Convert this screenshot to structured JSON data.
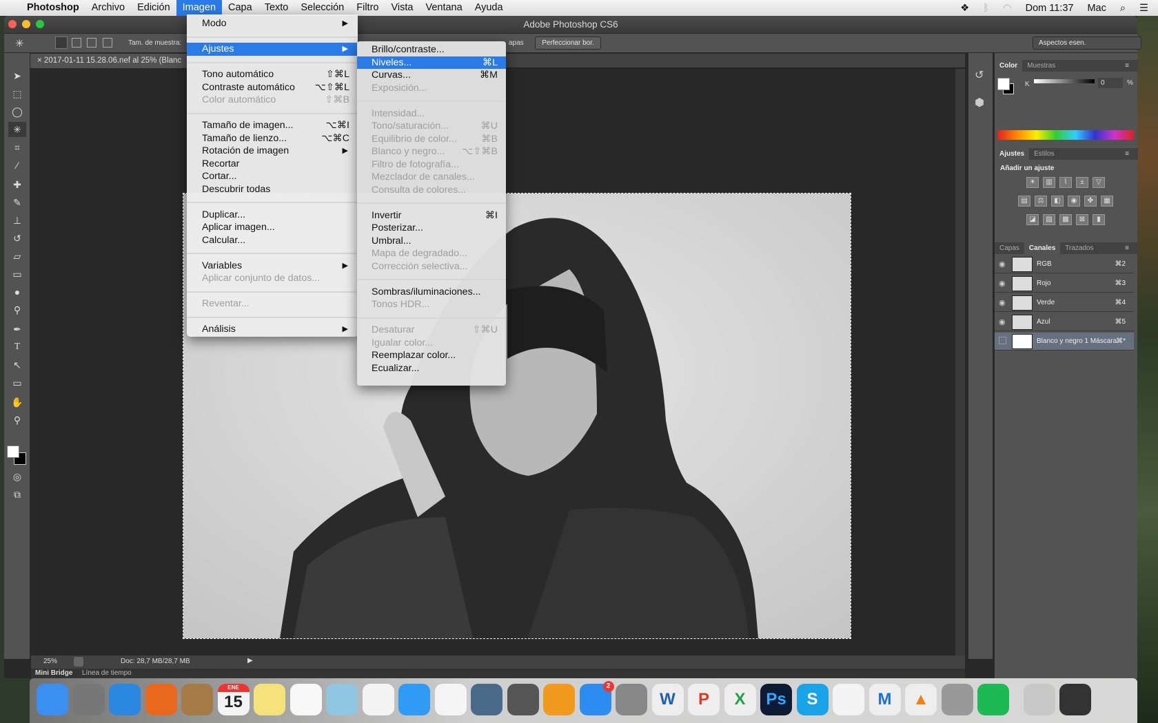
{
  "menubar": {
    "app": "Photoshop",
    "items": [
      "Archivo",
      "Edición",
      "Imagen",
      "Capa",
      "Texto",
      "Selección",
      "Filtro",
      "Vista",
      "Ventana",
      "Ayuda"
    ],
    "active": "Imagen",
    "clock": "Dom 11:37",
    "user": "Mac"
  },
  "window": {
    "title": "Adobe Photoshop CS6"
  },
  "options": {
    "sample_label": "Tam. de muestra:",
    "refine_button": "Perfeccionar bor.",
    "workspace": "Aspectos esen.",
    "layers_fragment": "apas"
  },
  "document": {
    "tab": "2017-01-11 15.28.06.nef al 25% (Blanc"
  },
  "status": {
    "zoom": "25%",
    "doc": "Doc: 28,7 MB/28,7 MB"
  },
  "bottom_tabs": [
    "Mini Bridge",
    "Línea de tiempo"
  ],
  "imagen_menu": [
    {
      "label": "Modo",
      "submenu": true
    },
    {
      "sep": true
    },
    {
      "label": "Ajustes",
      "submenu": true,
      "highlighted": true
    },
    {
      "sep": true
    },
    {
      "label": "Tono automático",
      "key": "⇧⌘L"
    },
    {
      "label": "Contraste automático",
      "key": "⌥⇧⌘L"
    },
    {
      "label": "Color automático",
      "key": "⇧⌘B",
      "disabled": true
    },
    {
      "sep": true
    },
    {
      "label": "Tamaño de imagen...",
      "key": "⌥⌘I"
    },
    {
      "label": "Tamaño de lienzo...",
      "key": "⌥⌘C"
    },
    {
      "label": "Rotación de imagen",
      "submenu": true
    },
    {
      "label": "Recortar"
    },
    {
      "label": "Cortar..."
    },
    {
      "label": "Descubrir todas"
    },
    {
      "sep": true
    },
    {
      "label": "Duplicar..."
    },
    {
      "label": "Aplicar imagen..."
    },
    {
      "label": "Calcular..."
    },
    {
      "sep": true
    },
    {
      "label": "Variables",
      "submenu": true
    },
    {
      "label": "Aplicar conjunto de datos...",
      "disabled": true
    },
    {
      "sep": true
    },
    {
      "label": "Reventar...",
      "disabled": true
    },
    {
      "sep": true
    },
    {
      "label": "Análisis",
      "submenu": true
    }
  ],
  "ajustes_submenu": [
    {
      "label": "Brillo/contraste..."
    },
    {
      "label": "Niveles...",
      "key": "⌘L",
      "highlighted": true
    },
    {
      "label": "Curvas...",
      "key": "⌘M"
    },
    {
      "label": "Exposición...",
      "disabled": true
    },
    {
      "sep": true
    },
    {
      "label": "Intensidad...",
      "disabled": true
    },
    {
      "label": "Tono/saturación...",
      "key": "⌘U",
      "disabled": true
    },
    {
      "label": "Equilibrio de color...",
      "key": "⌘B",
      "disabled": true
    },
    {
      "label": "Blanco y negro...",
      "key": "⌥⇧⌘B",
      "disabled": true
    },
    {
      "label": "Filtro de fotografía...",
      "disabled": true
    },
    {
      "label": "Mezclador de canales...",
      "disabled": true
    },
    {
      "label": "Consulta de colores...",
      "disabled": true
    },
    {
      "sep": true
    },
    {
      "label": "Invertir",
      "key": "⌘I"
    },
    {
      "label": "Posterizar..."
    },
    {
      "label": "Umbral..."
    },
    {
      "label": "Mapa de degradado...",
      "disabled": true
    },
    {
      "label": "Corrección selectiva...",
      "disabled": true
    },
    {
      "sep": true
    },
    {
      "label": "Sombras/iluminaciones..."
    },
    {
      "label": "Tonos HDR...",
      "disabled": true
    },
    {
      "sep": true
    },
    {
      "label": "Desaturar",
      "key": "⇧⌘U",
      "disabled": true
    },
    {
      "label": "Igualar color...",
      "disabled": true
    },
    {
      "label": "Reemplazar color..."
    },
    {
      "label": "Ecualizar..."
    }
  ],
  "color_panel": {
    "tabs": [
      "Color",
      "Muestras"
    ],
    "channel": "K",
    "value": "0",
    "unit": "%"
  },
  "adjust_panel": {
    "tabs": [
      "Ajustes",
      "Estilos"
    ],
    "heading": "Añadir un ajuste"
  },
  "channels_panel": {
    "tabs": [
      "Capas",
      "Canales",
      "Trazados"
    ],
    "active": "Canales",
    "rows": [
      {
        "name": "RGB",
        "key": "⌘2",
        "visible": true
      },
      {
        "name": "Rojo",
        "key": "⌘3",
        "visible": true
      },
      {
        "name": "Verde",
        "key": "⌘4",
        "visible": true
      },
      {
        "name": "Azul",
        "key": "⌘5",
        "visible": true
      },
      {
        "name": "Blanco y negro 1 Máscara",
        "key": "⌘*",
        "visible": false,
        "selected": true
      }
    ]
  },
  "dock": [
    {
      "name": "finder",
      "bg": "#3a8ff0",
      "text": ""
    },
    {
      "name": "launchpad",
      "bg": "#777",
      "text": ""
    },
    {
      "name": "safari",
      "bg": "#2a88e0",
      "text": ""
    },
    {
      "name": "firefox",
      "bg": "#e8681c",
      "text": ""
    },
    {
      "name": "contacts",
      "bg": "#a57a44",
      "text": ""
    },
    {
      "name": "calendar",
      "bg": "#f4f4f4",
      "text": "15",
      "sub": "ENE"
    },
    {
      "name": "notes",
      "bg": "#f6e27a",
      "text": ""
    },
    {
      "name": "reminders",
      "bg": "#f8f8f8",
      "text": ""
    },
    {
      "name": "maps",
      "bg": "#8fc6e0",
      "text": ""
    },
    {
      "name": "photos",
      "bg": "#f4f4f4",
      "text": ""
    },
    {
      "name": "messages",
      "bg": "#2f9bf4",
      "text": ""
    },
    {
      "name": "itunes",
      "bg": "#f5f5f5",
      "text": ""
    },
    {
      "name": "preview",
      "bg": "#4a6a8a",
      "text": ""
    },
    {
      "name": "imovie",
      "bg": "#555",
      "text": ""
    },
    {
      "name": "ibooks",
      "bg": "#f29a1e",
      "text": ""
    },
    {
      "name": "app-store",
      "bg": "#2d8cf0",
      "text": "",
      "badge": "2"
    },
    {
      "name": "system-preferences",
      "bg": "#888",
      "text": ""
    },
    {
      "name": "word",
      "bg": "#eee",
      "text": "W",
      "fg": "#1f5fb8"
    },
    {
      "name": "wps",
      "bg": "#eee",
      "text": "P",
      "fg": "#e03a1e"
    },
    {
      "name": "excel",
      "bg": "#eee",
      "text": "X",
      "fg": "#21a044"
    },
    {
      "name": "photoshop",
      "bg": "#0d1a33",
      "text": "Ps",
      "fg": "#31a8ff"
    },
    {
      "name": "skype",
      "bg": "#1ba3e8",
      "text": "S"
    },
    {
      "name": "acrobat",
      "bg": "#f4f4f4",
      "text": "",
      "fg": "#d21e1e"
    },
    {
      "name": "malwarebytes",
      "bg": "#eee",
      "text": "M",
      "fg": "#1f6fd8"
    },
    {
      "name": "vlc",
      "bg": "#eee",
      "text": "▲",
      "fg": "#f08010"
    },
    {
      "name": "utility",
      "bg": "#999",
      "text": ""
    },
    {
      "name": "spotify",
      "bg": "#1db954",
      "text": ""
    },
    {
      "name": "folder",
      "bg": "#c8c8c8",
      "text": ""
    },
    {
      "name": "terminal",
      "bg": "#333",
      "text": ""
    },
    {
      "name": "trash",
      "bg": "#d8d8d8",
      "text": ""
    }
  ],
  "colors": {
    "accent": "#2a7be8",
    "ps_panel": "#535353",
    "canvas_bg": "#282828"
  }
}
